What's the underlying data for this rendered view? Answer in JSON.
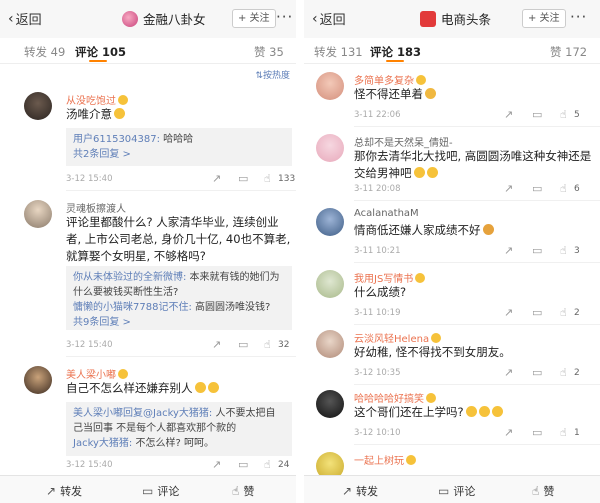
{
  "left": {
    "nav": {
      "back": "返回",
      "account": "金融八卦女",
      "follow": "+ 关注",
      "more": "···"
    },
    "tabs": {
      "repost": "转发 49",
      "comment": "评论 105",
      "like": "赞 35"
    },
    "sort": "按热度",
    "comments": [
      {
        "name": "从没吃饱过",
        "text": "汤唯介意",
        "reply_lines": [
          {
            "name": "用户6115304387:",
            "text": " 哈哈哈"
          }
        ],
        "reply_more": "共2条回复 >",
        "time": "3-12 15:40",
        "likes": "133"
      },
      {
        "name": "灵魂板擦渡人",
        "text": "评论里都酸什么? 人家清华毕业, 连续创业者, 上市公司老总, 身价几十亿, 40也不算老, 就算娶个女明星, 不够格吗?",
        "reply_lines": [
          {
            "name": "你从未体验过的全新微博:",
            "text": " 本来就有钱的她们为什么要被钱买断性生活?"
          },
          {
            "name": "慵懒的小猫咪7788记不住:",
            "text": " 高圆圆汤唯没钱?"
          }
        ],
        "reply_more": "共9条回复 >",
        "time": "3-12 15:40",
        "likes": "32"
      },
      {
        "name": "美人梁小嘟",
        "text": "自己不怎么样还嫌弃别人",
        "reply_lines": [
          {
            "name": "美人梁小嘟回复@Jacky大猪猪:",
            "text": " 人不要太把自己当回事 不是每个人都喜欢那个款的"
          },
          {
            "name": "Jacky大猪猪:",
            "text": " 不怎么样? 呵呵。"
          }
        ],
        "reply_more": "",
        "time": "3-12 15:40",
        "likes": "24"
      }
    ],
    "bottom": {
      "repost": "转发",
      "comment": "评论",
      "like": "赞"
    }
  },
  "right": {
    "nav": {
      "back": "返回",
      "account": "电商头条",
      "follow": "+ 关注",
      "more": "···"
    },
    "tabs": {
      "repost": "转发 131",
      "comment": "评论 183",
      "like": "赞 172"
    },
    "comments": [
      {
        "name": "多简单多复杂",
        "text": "怪不得还单着",
        "time": "3-11 22:06",
        "likes": "5"
      },
      {
        "name": "总却不是天然呆_倩妞-",
        "text": "那你去清华北大找吧, 高圆圆汤唯这种女神还是交给男神吧",
        "time": "3-11 20:08",
        "likes": "6"
      },
      {
        "name": "AcalanathaM",
        "text": "情商低还嫌人家成绩不好",
        "time": "3-11 10:21",
        "likes": "3"
      },
      {
        "name": "我用JS写情书",
        "text": "什么成绩?",
        "time": "3-11 10:19",
        "likes": "2"
      },
      {
        "name": "云淡风轻Helena",
        "text": "好幼稚, 怪不得找不到女朋友。",
        "time": "3-12 10:35",
        "likes": "2"
      },
      {
        "name": "哈哈哈哈好搞笑",
        "text": "这个哥们还在上学吗?",
        "time": "3-12 10:10",
        "likes": "1"
      },
      {
        "name": "一起上树玩",
        "text": "",
        "time": "",
        "likes": ""
      }
    ],
    "bottom": {
      "repost": "转发",
      "comment": "评论",
      "like": "赞"
    }
  }
}
